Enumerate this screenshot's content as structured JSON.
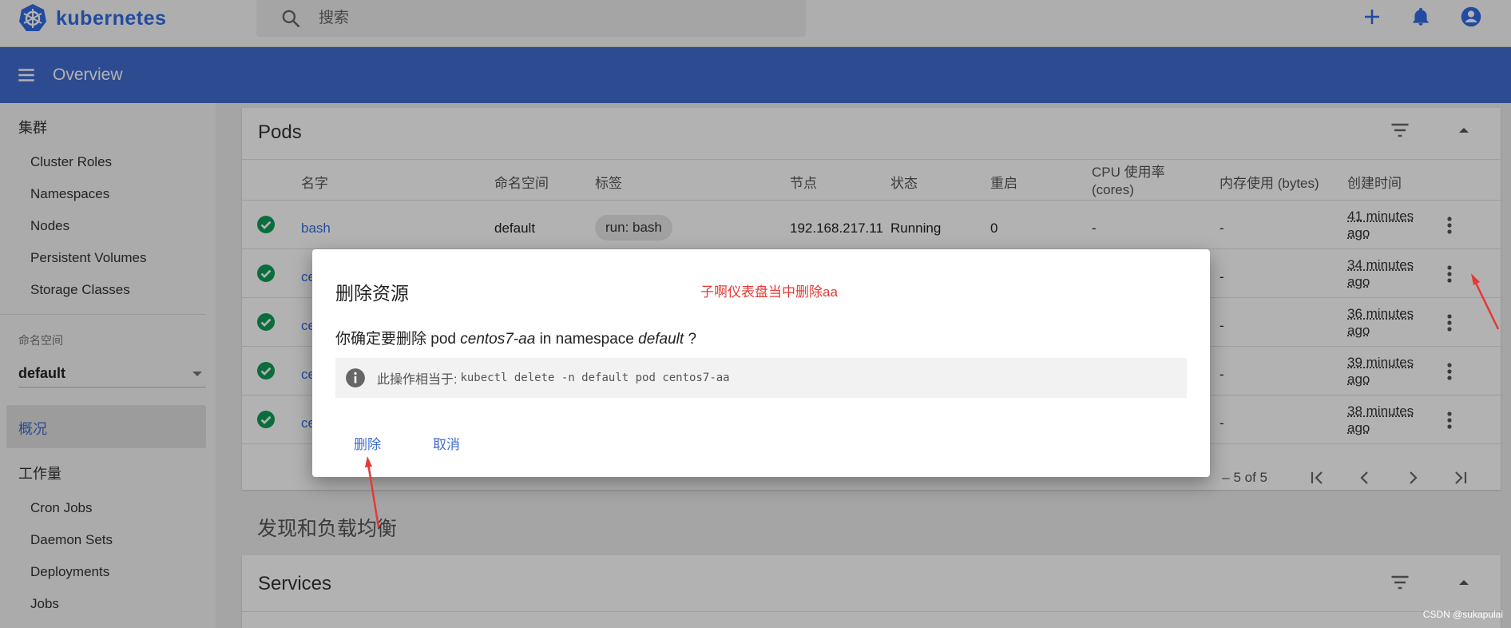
{
  "topbar": {
    "logo_text": "kubernetes",
    "search_placeholder": "搜索"
  },
  "header": {
    "title": "Overview"
  },
  "sidebar": {
    "cluster_section": "集群",
    "cluster_items": [
      "Cluster Roles",
      "Namespaces",
      "Nodes",
      "Persistent Volumes",
      "Storage Classes"
    ],
    "namespace_label": "命名空间",
    "namespace_value": "default",
    "overview_label": "概况",
    "workloads_section": "工作量",
    "workload_items": [
      "Cron Jobs",
      "Daemon Sets",
      "Deployments",
      "Jobs"
    ]
  },
  "pods": {
    "title": "Pods",
    "columns": [
      "名字",
      "命名空间",
      "标签",
      "节点",
      "状态",
      "重启",
      "CPU 使用率 (cores)",
      "内存使用 (bytes)",
      "创建时间"
    ],
    "cpu_col_line1": "CPU 使用率",
    "cpu_col_line2": "(cores)",
    "rows": [
      {
        "name": "bash",
        "namespace": "default",
        "label": "run: bash",
        "node": "192.168.217.11",
        "status": "Running",
        "restarts": "0",
        "cpu": "-",
        "memory": "-",
        "created_1": "41 minutes",
        "created_2": "ago"
      },
      {
        "name": "ce",
        "memory": "-",
        "created_1": "34 minutes",
        "created_2": "ago"
      },
      {
        "name": "ce",
        "memory": "-",
        "created_1": "36 minutes",
        "created_2": "ago"
      },
      {
        "name": "ce",
        "memory": "-",
        "created_1": "39 minutes",
        "created_2": "ago"
      },
      {
        "name": "ce",
        "memory": "-",
        "created_1": "38 minutes",
        "created_2": "ago"
      }
    ],
    "pagination": "– 5 of 5"
  },
  "discovery_heading": "发现和负载均衡",
  "services": {
    "title": "Services"
  },
  "dialog": {
    "title": "删除资源",
    "annotation": "子啊仪表盘当中删除aa",
    "msg_prefix": "你确定要删除 pod",
    "pod_name": "centos7-aa",
    "msg_middle": " in namespace",
    "namespace": "default",
    "msg_suffix": " ?",
    "info_label": "此操作相当于:",
    "command": "kubectl delete -n default pod centos7-aa",
    "delete_label": "删除",
    "cancel_label": "取消"
  },
  "watermark": "CSDN @sukapulai",
  "colors": {
    "brand": "#326ce5",
    "header": "#3f6cd0",
    "success": "#0f9d58",
    "annotation": "#e53935"
  }
}
